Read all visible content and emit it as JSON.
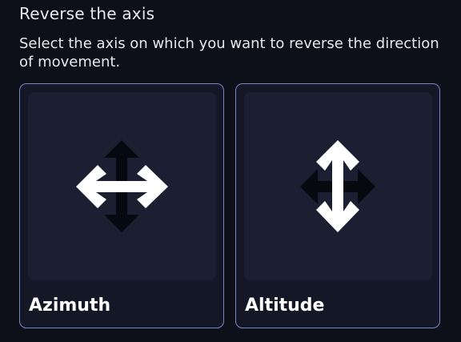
{
  "section": {
    "title": "Reverse the axis",
    "description": "Select the axis on which you want to reverse the direction of movement."
  },
  "options": [
    {
      "label": "Azimuth",
      "icon": "horizontal-arrows-icon"
    },
    {
      "label": "Altitude",
      "icon": "vertical-arrows-icon"
    }
  ],
  "colors": {
    "background": "#0d1019",
    "card": "#131726",
    "tile": "#1b1f31",
    "card_border": "#7b83c9",
    "active_arrow": "#ffffff",
    "inactive_arrow": "#070910"
  }
}
